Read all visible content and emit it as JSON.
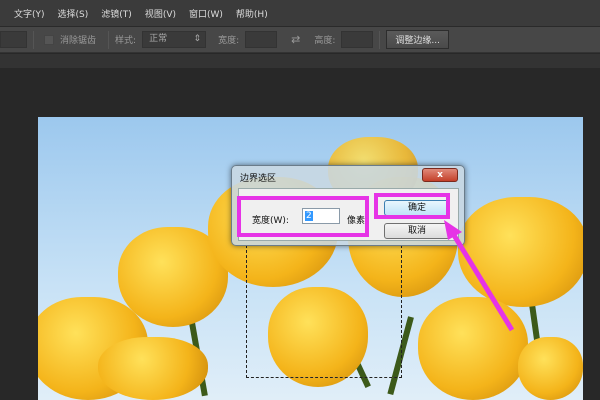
{
  "menu": [
    "文字(Y)",
    "选择(S)",
    "滤镜(T)",
    "视图(V)",
    "窗口(W)",
    "帮助(H)"
  ],
  "toolbar": {
    "antialias": "消除锯齿",
    "style_label": "样式:",
    "style_value": "正常",
    "width_label": "宽度:",
    "height_label": "高度:",
    "refine_edge": "调整边缘..."
  },
  "dialog": {
    "title": "边界选区",
    "close": "x",
    "width_label": "宽度(W):",
    "width_value": "2",
    "unit": "像素",
    "ok": "确定",
    "cancel": "取消"
  },
  "colors": {
    "highlight": "#e633e6"
  }
}
